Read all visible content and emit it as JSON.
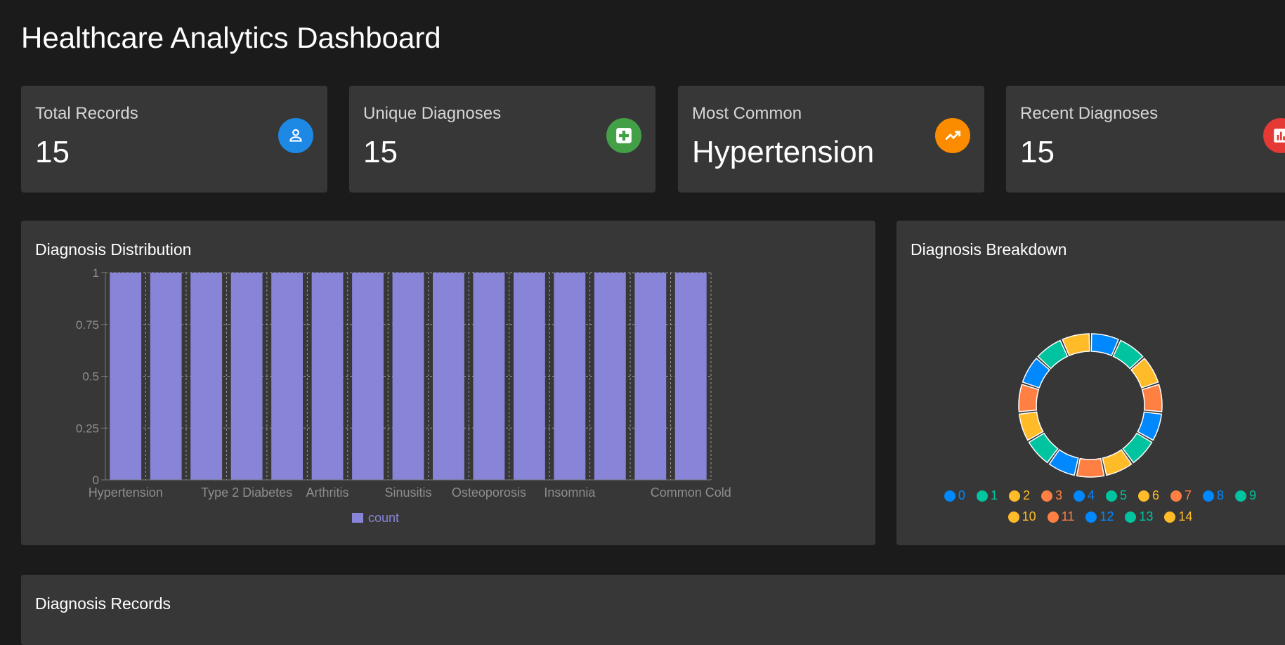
{
  "page_title": "Healthcare Analytics Dashboard",
  "stats": [
    {
      "label": "Total Records",
      "value": "15",
      "icon": "person-icon",
      "color": "#1e88e5"
    },
    {
      "label": "Unique Diagnoses",
      "value": "15",
      "icon": "medical-cross-icon",
      "color": "#43a047"
    },
    {
      "label": "Most Common",
      "value": "Hypertension",
      "icon": "trending-up-icon",
      "color": "#fb8c00"
    },
    {
      "label": "Recent Diagnoses",
      "value": "15",
      "icon": "bar-chart-icon",
      "color": "#e53935"
    }
  ],
  "distribution_panel": {
    "title": "Diagnosis Distribution"
  },
  "breakdown_panel": {
    "title": "Diagnosis Breakdown"
  },
  "records_panel": {
    "title": "Diagnosis Records"
  },
  "chart_data": [
    {
      "type": "bar",
      "title": "Diagnosis Distribution",
      "categories": [
        "Hypertension",
        "",
        "",
        "Type 2 Diabetes",
        "",
        "Arthritis",
        "",
        "Sinusitis",
        "",
        "Osteoporosis",
        "",
        "Insomnia",
        "",
        "",
        "Common Cold"
      ],
      "series": [
        {
          "name": "count",
          "values": [
            1,
            1,
            1,
            1,
            1,
            1,
            1,
            1,
            1,
            1,
            1,
            1,
            1,
            1,
            1
          ],
          "color": "#8884d8"
        }
      ],
      "yticks": [
        "0",
        "0.25",
        "0.5",
        "0.75",
        "1"
      ],
      "ylim": [
        0,
        1
      ],
      "grid": true,
      "legend": "bottom"
    },
    {
      "type": "pie",
      "title": "Diagnosis Breakdown",
      "labels": [
        "0",
        "1",
        "2",
        "3",
        "4",
        "5",
        "6",
        "7",
        "8",
        "9",
        "10",
        "11",
        "12",
        "13",
        "14"
      ],
      "values": [
        1,
        1,
        1,
        1,
        1,
        1,
        1,
        1,
        1,
        1,
        1,
        1,
        1,
        1,
        1
      ],
      "colors": [
        "#0088fe",
        "#00c49f",
        "#ffbb28",
        "#ff8042"
      ],
      "legend": "bottom"
    }
  ]
}
